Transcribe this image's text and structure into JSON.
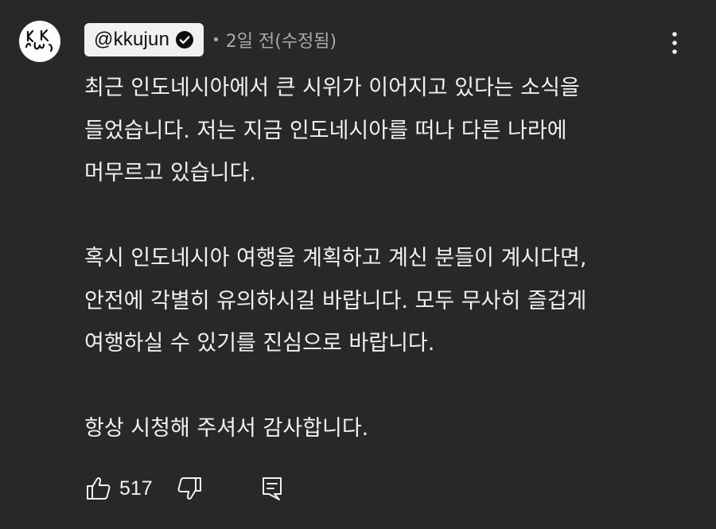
{
  "comment": {
    "author": {
      "handle": "@kkujun",
      "verified": true,
      "avatar_initials": "KKU"
    },
    "meta": {
      "separator": "•",
      "time": "2일 전(수정됨)"
    },
    "body": {
      "paragraphs": [
        [
          "최근 인도네시아에서 큰 시위가 이어지고 있다는 소식을",
          "들었습니다. 저는 지금 인도네시아를 떠나 다른 나라에",
          "머무르고 있습니다."
        ],
        [
          "혹시 인도네시아 여행을 계획하고 계신 분들이 계시다면,",
          "안전에 각별히 유의하시길 바랍니다. 모두 무사히 즐겁게",
          "여행하실 수 있기를 진심으로 바랍니다."
        ],
        [
          "항상 시청해 주셔서 감사합니다."
        ]
      ]
    },
    "actions": {
      "like_count": "517",
      "icons": {
        "like": "thumbs-up-icon",
        "dislike": "thumbs-down-icon",
        "reply": "reply-comment-icon",
        "menu": "more-vert-icon",
        "verified": "verified-check-icon"
      }
    }
  },
  "colors": {
    "background": "#282828",
    "text": "#f1f1f1",
    "meta": "#aaaaaa",
    "chip": "#f1f1f1"
  }
}
